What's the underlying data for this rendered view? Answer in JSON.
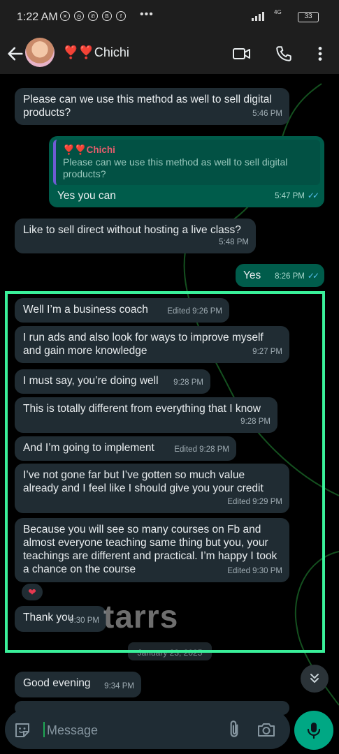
{
  "status_bar": {
    "time": "1:22 AM",
    "network": "4G",
    "battery": "33"
  },
  "header": {
    "contact_name": "❣️❣️Chichi",
    "icons": [
      "back-arrow-icon",
      "video-call-icon",
      "phone-icon",
      "more-vert-icon"
    ]
  },
  "messages": [
    {
      "dir": "in",
      "text": "Please can we use this method as well to sell digital products?",
      "time": "5:46 PM"
    },
    {
      "dir": "out",
      "quote_name": "❣️❣️Chichi",
      "quote_text": "Please can we use this method as well to sell digital products?",
      "text": "Yes you can",
      "time": "5:47 PM",
      "status": "read"
    },
    {
      "dir": "in",
      "text": "Like to sell direct without hosting a live class?",
      "time": "5:48 PM"
    },
    {
      "dir": "out",
      "text": "Yes",
      "time": "8:26 PM",
      "status": "read"
    },
    {
      "dir": "in",
      "text": "Well I’m a business coach",
      "time": "Edited 9:26 PM"
    },
    {
      "dir": "in",
      "text": "I run ads and also look for ways to improve myself and gain more knowledge",
      "time": "9:27 PM"
    },
    {
      "dir": "in",
      "text": "I must say, you’re doing well",
      "time": "9:28 PM"
    },
    {
      "dir": "in",
      "text": "This is totally different from everything that I know",
      "time": "9:28 PM"
    },
    {
      "dir": "in",
      "text": "And I’m going to implement",
      "time": "Edited 9:28 PM"
    },
    {
      "dir": "in",
      "text": "I’ve not gone far but I’ve gotten so much value already and I feel like I should give you your credit",
      "time": "Edited 9:29 PM"
    },
    {
      "dir": "in",
      "text": "Because you will see so many courses on Fb and almost everyone teaching same thing but you, your teachings are different and practical. I’m happy I took a chance on the course",
      "time": "Edited 9:30 PM",
      "reaction": "❤"
    },
    {
      "dir": "in",
      "text": "Thank you",
      "time": "9:30 PM"
    },
    {
      "dir": "in",
      "text": "Good evening",
      "time": "9:34 PM"
    }
  ],
  "date_chip": "January 23, 2025",
  "watermark": "tarrs",
  "composer": {
    "placeholder": "Message"
  },
  "colors": {
    "incoming_bubble": "#202c33",
    "outgoing_bubble": "#005c4b",
    "accent": "#00a884",
    "highlight_box": "#3af09a",
    "read_ticks": "#53bdeb"
  }
}
